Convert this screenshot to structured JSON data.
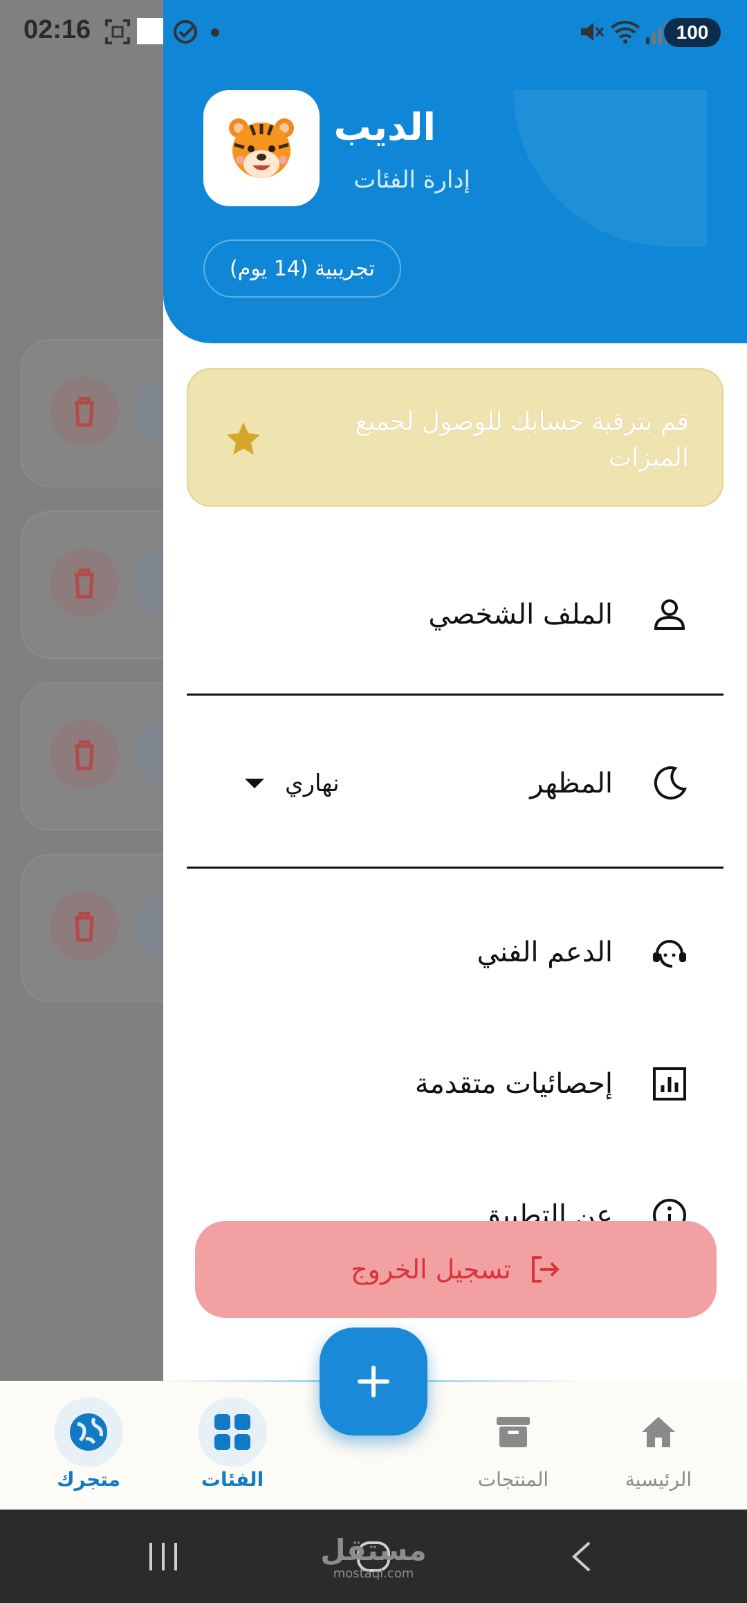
{
  "status_bar": {
    "time": "02:16",
    "battery": "100",
    "icons": [
      "screenshot-icon",
      "app-badge-icon",
      "check-circle-icon",
      "dot-icon",
      "mute-icon",
      "wifi-icon",
      "signal-icon"
    ]
  },
  "drawer": {
    "header": {
      "name": "الديب",
      "subtitle": "إدارة الفئات",
      "trial": "تجريبية (14 يوم)",
      "avatar": "tiger-avatar-icon"
    },
    "upgrade": {
      "text": "قم بترقية حسابك للوصول لجميع الميزات",
      "icon": "star-icon"
    },
    "menu": {
      "profile": "الملف الشخصي",
      "appearance": "المظهر",
      "appearance_value": "نهاري",
      "support": "الدعم الفني",
      "stats": "إحصائيات متقدمة",
      "about": "عن التطبيق"
    },
    "logout": "تسجيل الخروج"
  },
  "bottom_nav": {
    "store": "متجرك",
    "categories": "الفئات",
    "products": "المنتجات",
    "home": "الرئيسية"
  },
  "system_bar": {
    "watermark": "مستقل",
    "watermark_sub": "mostaql.com"
  },
  "colors": {
    "primary": "#0f87d6",
    "upgrade_bg": "#efe3b0",
    "star": "#d4a72c",
    "logout_bg": "#f3a0a2",
    "logout_text": "#d9343a"
  }
}
